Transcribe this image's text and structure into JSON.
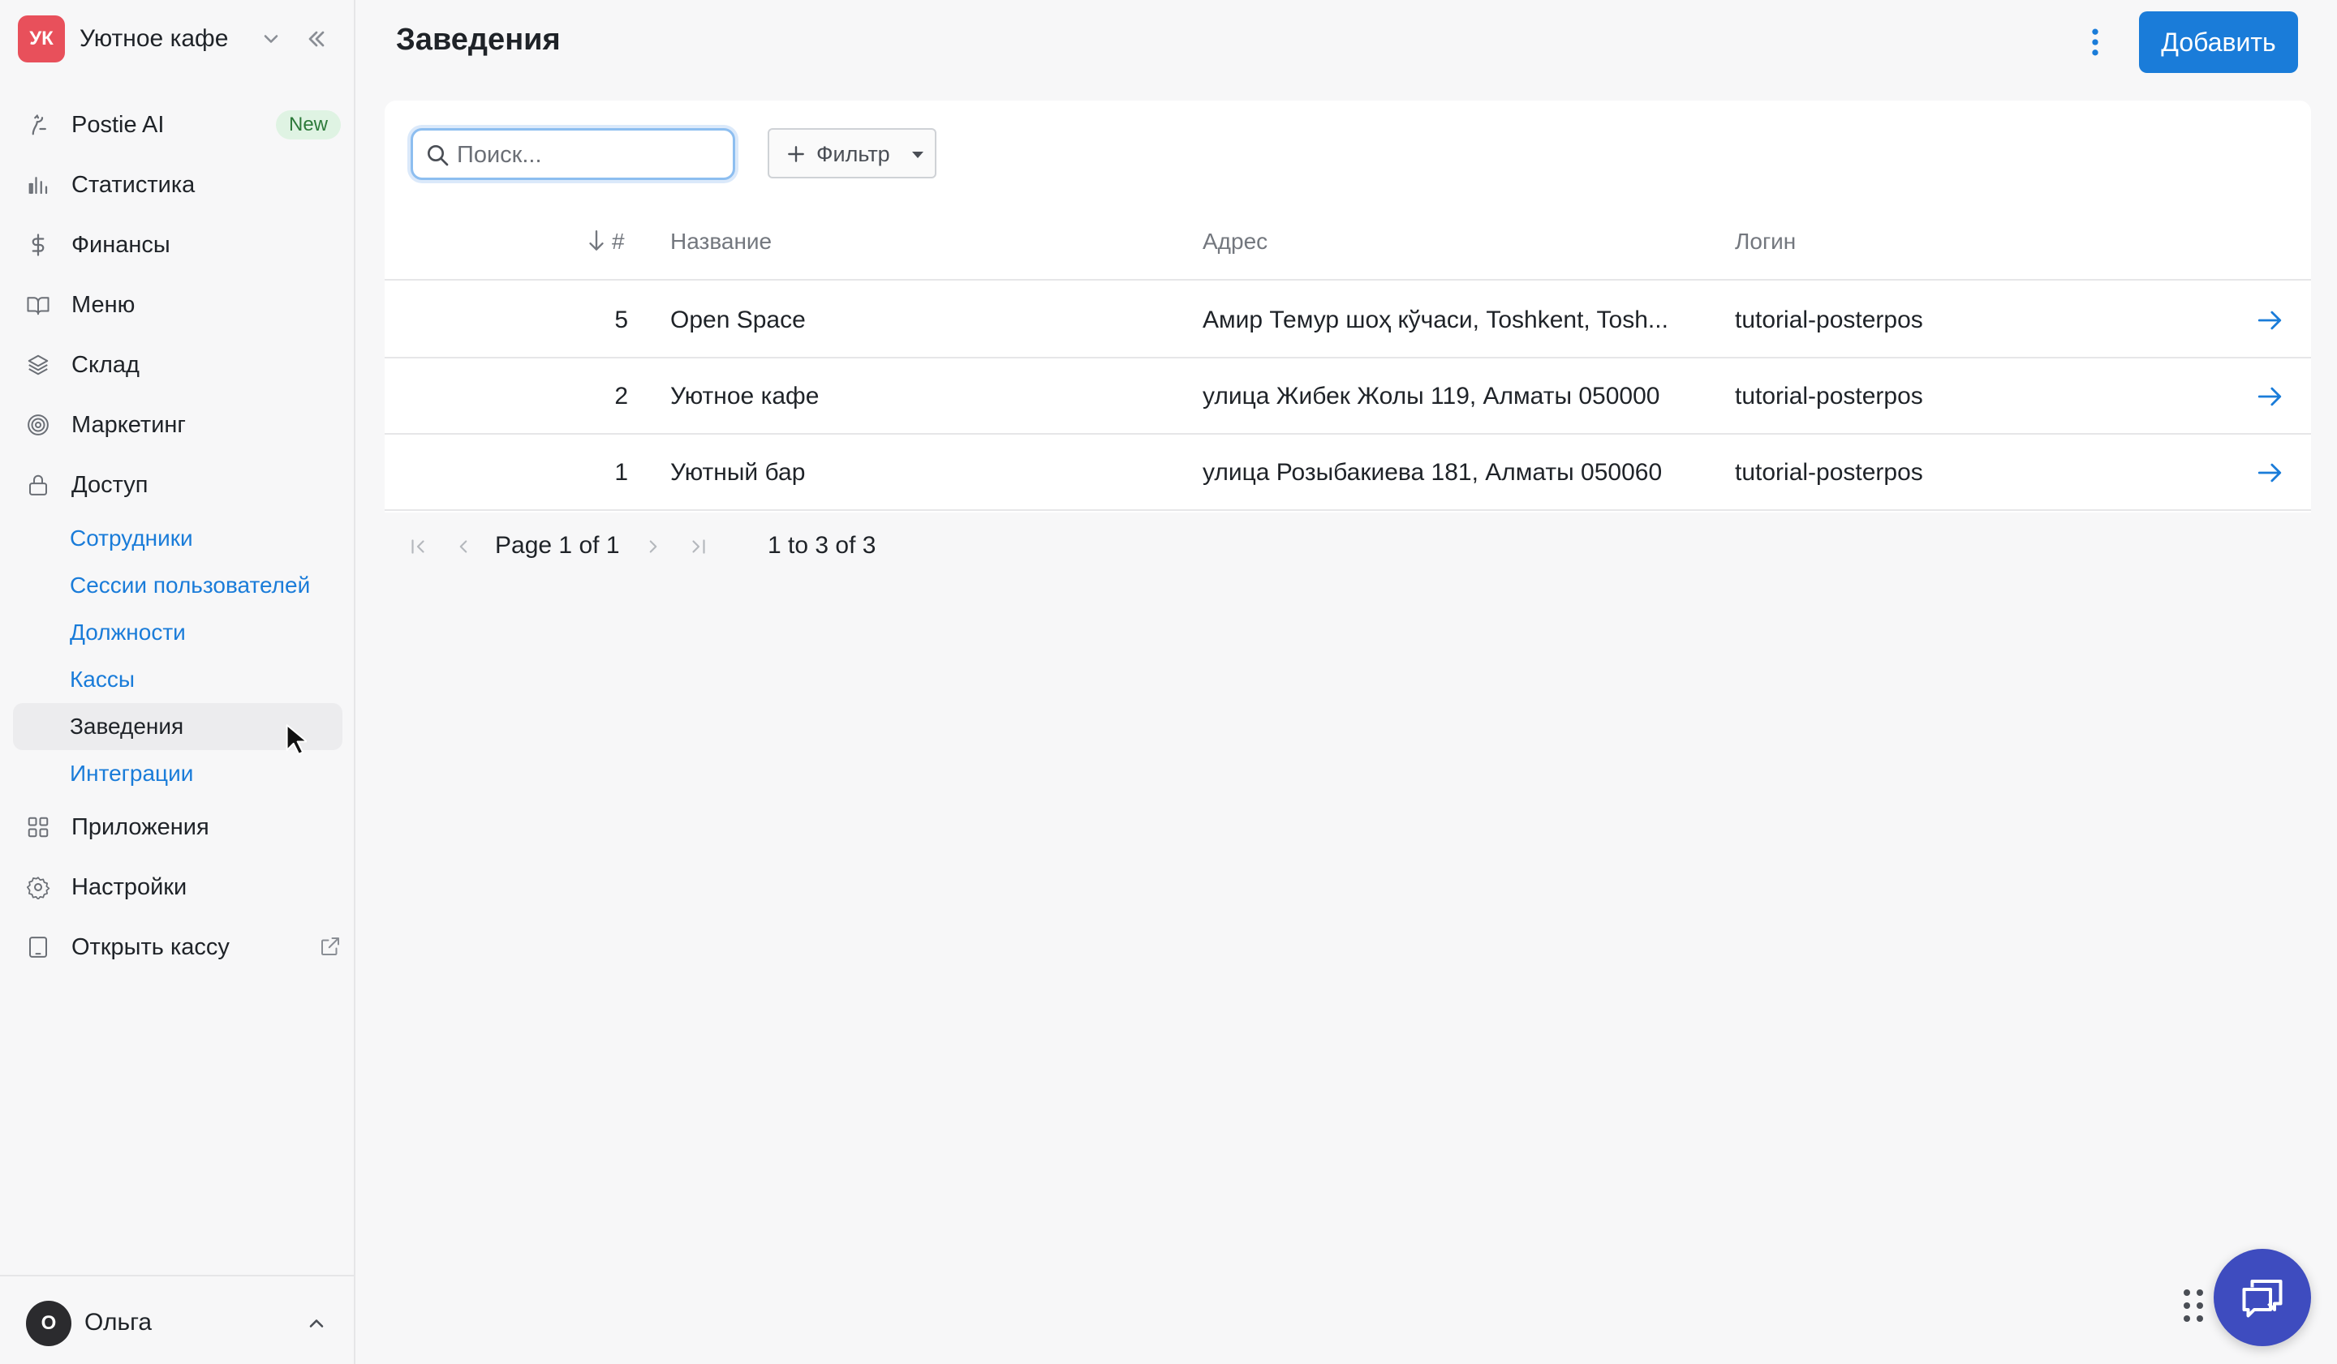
{
  "brand": {
    "initials": "УК",
    "name": "Уютное кафе"
  },
  "sidebar": {
    "items": [
      {
        "label": "Postie AI",
        "icon": "postie-ai-icon",
        "badge": "New"
      },
      {
        "label": "Статистика",
        "icon": "bar-chart-icon"
      },
      {
        "label": "Финансы",
        "icon": "dollar-icon"
      },
      {
        "label": "Меню",
        "icon": "book-icon"
      },
      {
        "label": "Склад",
        "icon": "layers-icon"
      },
      {
        "label": "Маркетинг",
        "icon": "target-icon"
      },
      {
        "label": "Доступ",
        "icon": "lock-icon"
      }
    ],
    "access_sub": [
      {
        "label": "Сотрудники"
      },
      {
        "label": "Сессии пользователей"
      },
      {
        "label": "Должности"
      },
      {
        "label": "Кассы"
      },
      {
        "label": "Заведения",
        "active": true
      },
      {
        "label": "Интеграции"
      }
    ],
    "bottom_items": [
      {
        "label": "Приложения",
        "icon": "grid-icon"
      },
      {
        "label": "Настройки",
        "icon": "gear-icon"
      },
      {
        "label": "Открыть кассу",
        "icon": "tablet-icon"
      }
    ]
  },
  "user": {
    "initial": "О",
    "name": "Ольга"
  },
  "header": {
    "title": "Заведения",
    "add_label": "Добавить"
  },
  "search": {
    "placeholder": "Поиск...",
    "value": ""
  },
  "filter": {
    "label": "Фильтр"
  },
  "table": {
    "columns": [
      "#",
      "Название",
      "Адрес",
      "Логин"
    ],
    "sort_column": "#",
    "rows": [
      {
        "id": "5",
        "name": "Open Space",
        "address": "Амир Темур шоҳ кўчаси, Toshkent, Tosh...",
        "login": "tutorial-posterpos"
      },
      {
        "id": "2",
        "name": "Уютное кафе",
        "address": "улица Жибек Жолы 119, Алматы 050000",
        "login": "tutorial-posterpos"
      },
      {
        "id": "1",
        "name": "Уютный бар",
        "address": "улица Розыбакиева 181, Алматы 050060",
        "login": "tutorial-posterpos"
      }
    ]
  },
  "pager": {
    "page_word": "Page",
    "page": "1",
    "of_word": "of",
    "total_pages": "1",
    "range": "1 to 3 of 3"
  },
  "colors": {
    "accent": "#1a7cd9",
    "brand_avatar": "#e8505b",
    "chat": "#3e4cbf",
    "badge_bg": "#dff3e3"
  }
}
